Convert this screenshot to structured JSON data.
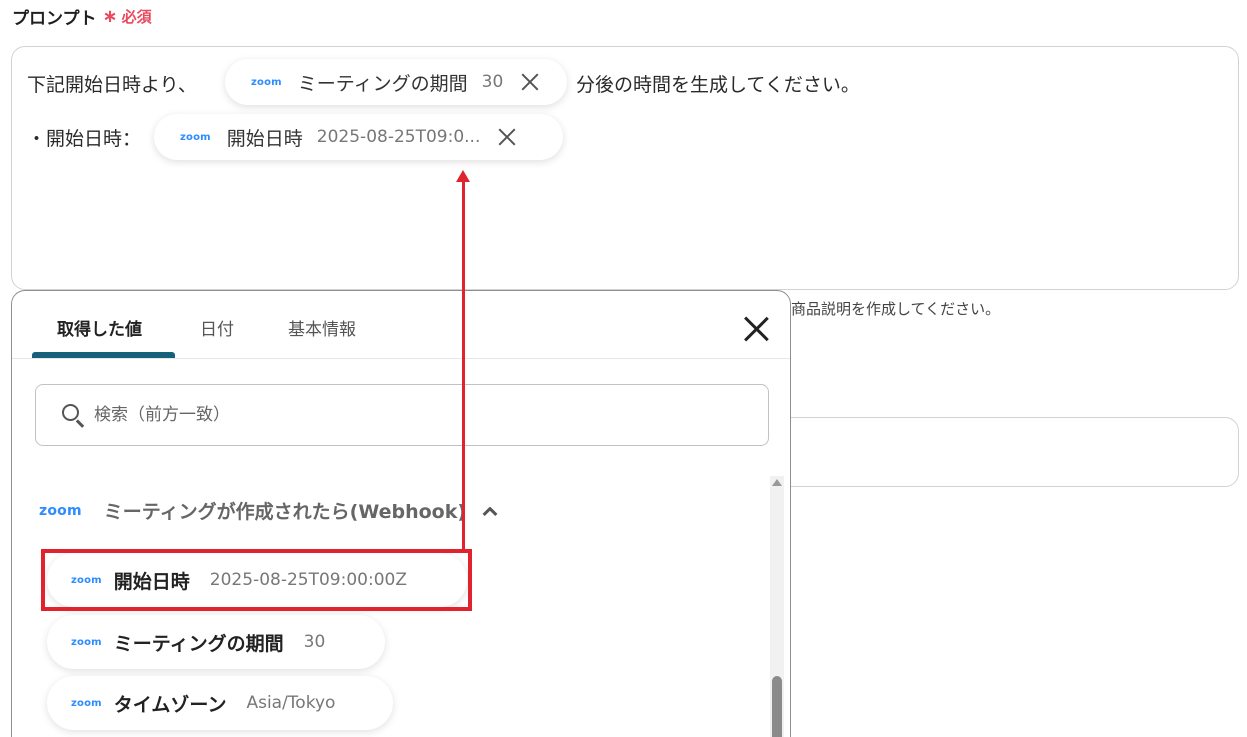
{
  "field": {
    "label": "プロンプト",
    "required_star": "∗",
    "required_text": "必須"
  },
  "prompt": {
    "line1_before": "下記開始日時より、",
    "line1_after": "分後の時間を生成してください。",
    "line2_prefix": "・開始日時：",
    "chips": [
      {
        "logo": "zoom",
        "label": "ミーティングの期間",
        "value": "30"
      },
      {
        "logo": "zoom",
        "label": "開始日時",
        "value": "2025-08-25T09:0..."
      }
    ]
  },
  "hint_text": "商品説明を作成してください。",
  "panel": {
    "tabs": [
      {
        "label": "取得した値",
        "active": true
      },
      {
        "label": "日付",
        "active": false
      },
      {
        "label": "基本情報",
        "active": false
      }
    ],
    "search_placeholder": "検索（前方一致）",
    "group": {
      "logo": "zoom",
      "title": "ミーティングが作成されたら(Webhook)",
      "expanded": true
    },
    "items": [
      {
        "logo": "zoom",
        "label": "開始日時",
        "value": "2025-08-25T09:00:00Z",
        "highlighted": true
      },
      {
        "logo": "zoom",
        "label": "ミーティングの期間",
        "value": "30"
      },
      {
        "logo": "zoom",
        "label": "タイムゾーン",
        "value": "Asia/Tokyo"
      }
    ]
  },
  "colors": {
    "required": "#e84a5f",
    "tab_underline": "#16607a",
    "zoom_blue": "#2d8cff",
    "annotation_red": "#e0232e"
  },
  "icons": [
    "close-icon",
    "search-icon",
    "chevron-up-icon",
    "zoom-logo"
  ]
}
